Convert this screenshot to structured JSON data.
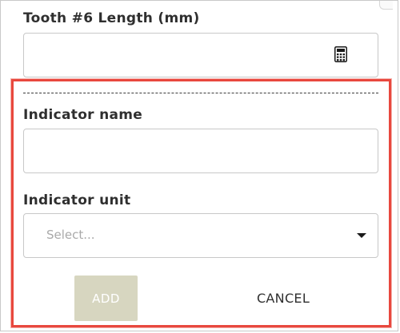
{
  "tooth_field": {
    "label": "Tooth #6 Length (mm)",
    "value": "",
    "icon": "calculator-icon"
  },
  "indicator_form": {
    "name_label": "Indicator name",
    "name_value": "",
    "unit_label": "Indicator unit",
    "unit_placeholder": "Select...",
    "add_label": "ADD",
    "cancel_label": "CANCEL"
  },
  "colors": {
    "highlight_border": "#e8483e",
    "add_button_disabled": "#d7d6c0"
  }
}
